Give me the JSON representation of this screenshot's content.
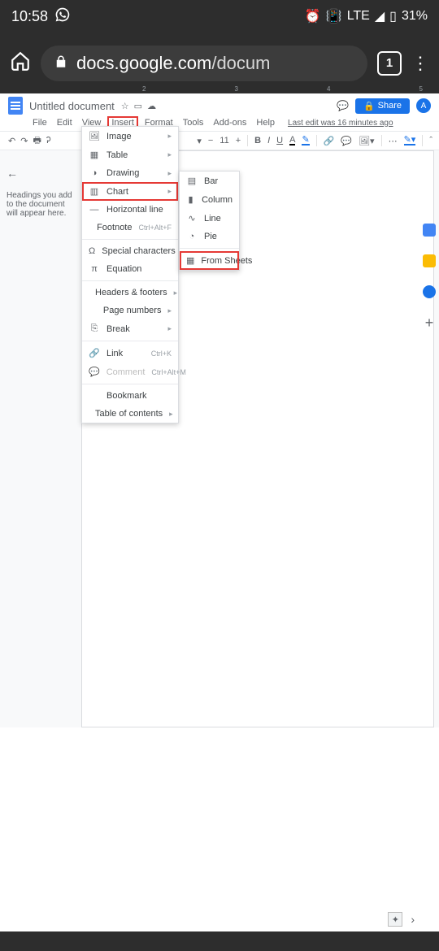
{
  "status": {
    "time": "10:58",
    "lte": "LTE",
    "battery": "31%",
    "tabs": "1"
  },
  "url": {
    "host": "docs.google.com",
    "path": "/docum"
  },
  "doc": {
    "title": "Untitled document",
    "last_edit": "Last edit was 16 minutes ago",
    "share": "Share",
    "avatar": "A"
  },
  "menubar": [
    "File",
    "Edit",
    "View",
    "Insert",
    "Format",
    "Tools",
    "Add-ons",
    "Help"
  ],
  "toolbar": {
    "fontsize": "11"
  },
  "outline": {
    "hint": "Headings you add to the document will appear here."
  },
  "insert_menu": {
    "image": "Image",
    "table": "Table",
    "drawing": "Drawing",
    "chart": "Chart",
    "hline": "Horizontal line",
    "footnote": "Footnote",
    "footnote_sc": "Ctrl+Alt+F",
    "special": "Special characters",
    "equation": "Equation",
    "hf": "Headers & footers",
    "pagenum": "Page numbers",
    "break": "Break",
    "link": "Link",
    "link_sc": "Ctrl+K",
    "comment": "Comment",
    "comment_sc": "Ctrl+Alt+M",
    "bookmark": "Bookmark",
    "toc": "Table of contents"
  },
  "chart_submenu": {
    "bar": "Bar",
    "column": "Column",
    "line": "Line",
    "pie": "Pie",
    "sheets": "From Sheets"
  }
}
